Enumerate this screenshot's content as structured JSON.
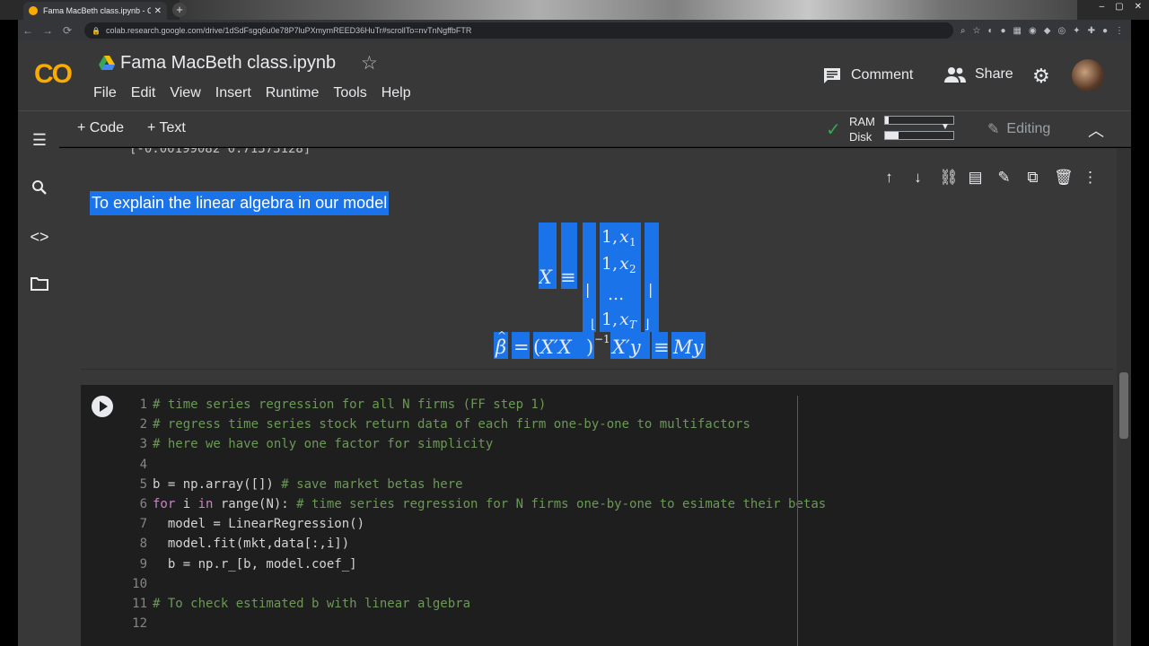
{
  "browser": {
    "tab_title": "Fama MacBeth class.ipynb - Co",
    "url": "colab.research.google.com/drive/1dSdFsgq6u0e78P7luPXmymREED36HuTr#scrollTo=nvTnNgffbFTR"
  },
  "header": {
    "logo": "CO",
    "notebook_title": "Fama MacBeth class.ipynb",
    "menu": [
      "File",
      "Edit",
      "View",
      "Insert",
      "Runtime",
      "Tools",
      "Help"
    ],
    "comment_label": "Comment",
    "share_label": "Share"
  },
  "toolbar": {
    "add_code": "+ Code",
    "add_text": "+ Text",
    "ram_label": "RAM",
    "disk_label": "Disk",
    "ram_usage": 0.05,
    "disk_usage": 0.2,
    "editing_label": "Editing"
  },
  "output_tail": "[-0.00199082  0.71373128]",
  "text_cell": {
    "heading": "To explain the linear algebra in our model"
  },
  "code_cell": {
    "lines": [
      {
        "no": "1",
        "segs": [
          {
            "t": "# time series regression for all N firms (FF step 1)",
            "k": "c"
          }
        ]
      },
      {
        "no": "2",
        "segs": [
          {
            "t": "# regress time series stock return data of each firm one-by-one to multifactors",
            "k": "c"
          }
        ]
      },
      {
        "no": "3",
        "segs": [
          {
            "t": "# here we have only one factor for simplicity",
            "k": "c"
          }
        ]
      },
      {
        "no": "4",
        "segs": []
      },
      {
        "no": "5",
        "segs": [
          {
            "t": "b = np.array([]) ",
            "k": ""
          },
          {
            "t": "# save market betas here",
            "k": "c"
          }
        ]
      },
      {
        "no": "6",
        "segs": [
          {
            "t": "for",
            "k": "k"
          },
          {
            "t": " i ",
            "k": ""
          },
          {
            "t": "in",
            "k": "k"
          },
          {
            "t": " range(N): ",
            "k": ""
          },
          {
            "t": "# time series regression for N firms one-by-one to esimate their betas",
            "k": "c"
          }
        ]
      },
      {
        "no": "7",
        "segs": [
          {
            "t": "  model = LinearRegression()",
            "k": ""
          }
        ]
      },
      {
        "no": "8",
        "segs": [
          {
            "t": "  model.fit(mkt,data[:,i])",
            "k": ""
          }
        ]
      },
      {
        "no": "9",
        "segs": [
          {
            "t": "  b = np.r_[b, model.coef_]",
            "k": ""
          }
        ]
      },
      {
        "no": "10",
        "segs": []
      },
      {
        "no": "11",
        "segs": [
          {
            "t": "# To check estimated b with linear algebra",
            "k": "c"
          }
        ]
      },
      {
        "no": "12",
        "segs": []
      }
    ]
  },
  "icons": {
    "comment": "comment-icon",
    "share": "people-icon",
    "settings": "gear-icon",
    "toc": "list-icon",
    "search": "search-icon",
    "code_snippets": "code-icon",
    "files": "folder-icon"
  },
  "colors": {
    "accent": "#f9ab00",
    "selection": "#1a73e8",
    "connected": "#34a853"
  }
}
